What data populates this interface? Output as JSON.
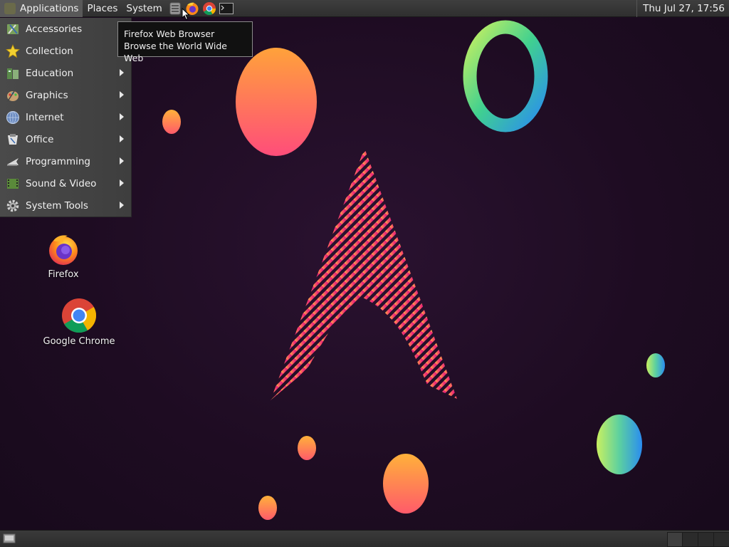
{
  "top_panel": {
    "menus": [
      "Applications",
      "Places",
      "System"
    ],
    "launchers": [
      "terminal-notes-icon",
      "firefox-icon",
      "chrome-icon",
      "terminal-icon"
    ],
    "clock": "Thu Jul 27, 17:56"
  },
  "tooltip": {
    "title": "Firefox Web Browser",
    "subtitle": "Browse the World Wide Web"
  },
  "apps_menu": {
    "items": [
      {
        "label": "Accessories",
        "icon": "accessories-icon",
        "submenu": false
      },
      {
        "label": "Collection",
        "icon": "star-icon",
        "submenu": false
      },
      {
        "label": "Education",
        "icon": "education-icon",
        "submenu": true
      },
      {
        "label": "Graphics",
        "icon": "graphics-icon",
        "submenu": true
      },
      {
        "label": "Internet",
        "icon": "globe-icon",
        "submenu": true
      },
      {
        "label": "Office",
        "icon": "office-icon",
        "submenu": true
      },
      {
        "label": "Programming",
        "icon": "programming-icon",
        "submenu": true
      },
      {
        "label": "Sound & Video",
        "icon": "media-icon",
        "submenu": true
      },
      {
        "label": "System Tools",
        "icon": "gear-icon",
        "submenu": true
      }
    ]
  },
  "desktop_icons": [
    {
      "label": "Firefox",
      "icon": "firefox-icon"
    },
    {
      "label": "Google Chrome",
      "icon": "chrome-icon"
    }
  ],
  "colors": {
    "background": "#1e0c22",
    "accent_pink": "#e8347a",
    "accent_orange": "#ff9a3c"
  }
}
